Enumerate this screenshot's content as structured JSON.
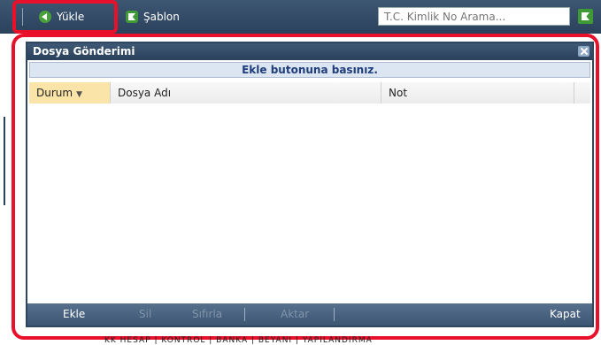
{
  "toolbar": {
    "load_label": "Yükle",
    "template_label": "Şablon",
    "search_placeholder": "T.C. Kimlik No Arama..."
  },
  "dialog": {
    "title": "Dosya Gönderimi",
    "info_message": "Ekle butonuna basınız.",
    "columns": [
      "Durum",
      "Dosya Adı",
      "Not"
    ],
    "footer": {
      "add_label": "Ekle",
      "delete_label": "Sil",
      "reset_label": "Sıfırla",
      "transfer_label": "Aktar",
      "close_label": "Kapat"
    }
  },
  "background": {
    "bottom_text": "KK  HESAP  |  KONTROL  |  BANKA  |  BEYANI  |  YAPILANDIRMA"
  },
  "colors": {
    "highlight": "#e8102a",
    "toolbar": "#2b425c",
    "sorted_column": "#fbe4a8"
  }
}
